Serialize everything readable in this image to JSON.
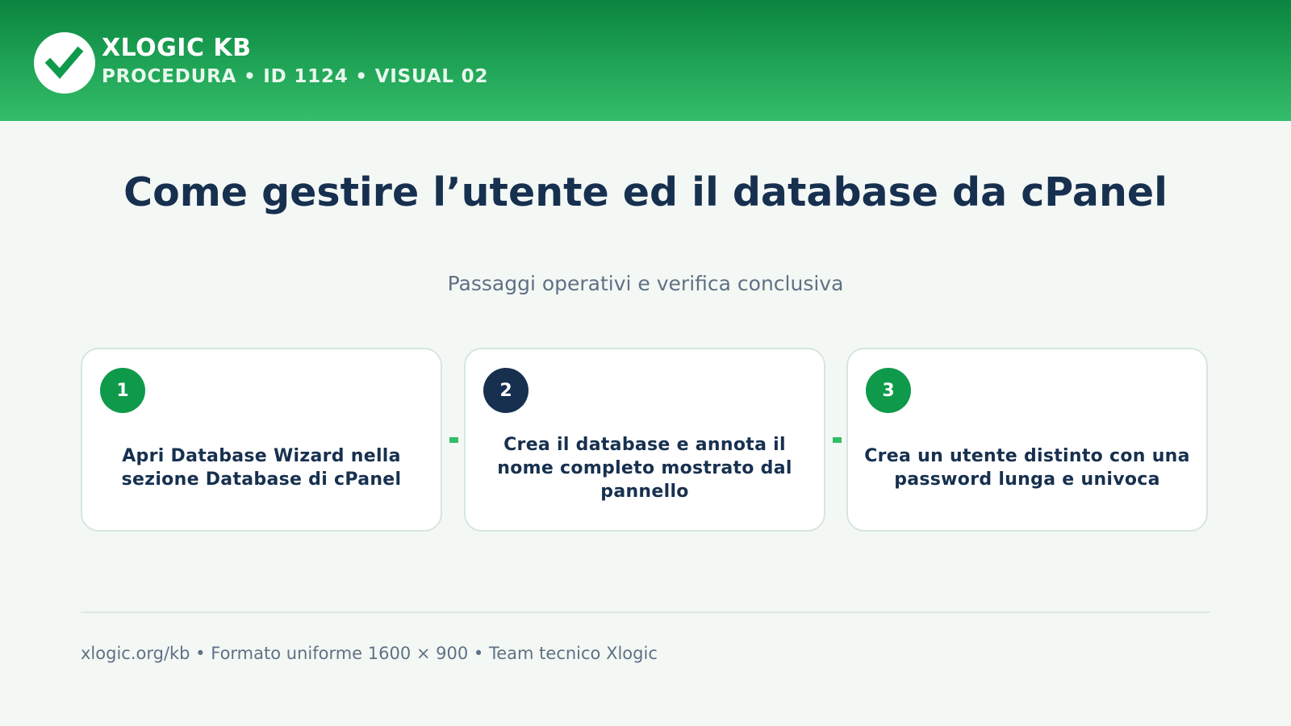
{
  "header": {
    "logo_icon": "check-icon",
    "brand": "XLOGIC KB",
    "subtitle": "PROCEDURA • ID 1124 • VISUAL 02",
    "colors": {
      "gradient_top": "#0a843f",
      "gradient_bottom": "#34bd6a"
    }
  },
  "main": {
    "title": "Come gestire l’utente ed il database da cPanel",
    "subtitle": "Passaggi operativi e verifica conclusiva",
    "steps": [
      {
        "number": "1",
        "badge_color": "#0e9a4a",
        "text": "Apri Database Wizard nella sezione Database di cPanel"
      },
      {
        "number": "2",
        "badge_color": "#17304f",
        "text": "Crea il database e annota il nome completo mostrato dal pannello"
      },
      {
        "number": "3",
        "badge_color": "#0e9a4a",
        "text": "Crea un utente distinto con una password lunga e univoca"
      }
    ]
  },
  "footer": {
    "text": "xlogic.org/kb • Formato uniforme 1600 × 900 • Team tecnico Xlogic"
  }
}
